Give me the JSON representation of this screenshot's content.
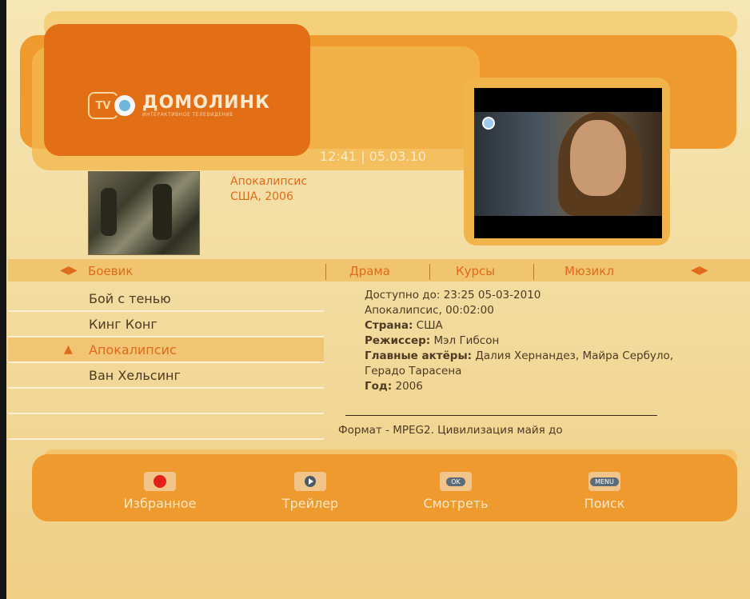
{
  "header": {
    "logo_badge": "TV",
    "logo_name": "ДОМОЛИНК",
    "logo_tagline": "ИНТЕРАКТИВНОЕ ТЕЛЕВИДЕНИЕ",
    "datetime": "12:41 | 05.03.10"
  },
  "movie": {
    "title": "Апокалипсис",
    "country_year": "США, 2006"
  },
  "categories": {
    "active": "Боевик",
    "items": [
      "Драма",
      "Курсы",
      "Мюзикл"
    ]
  },
  "list": {
    "items": [
      "Бой с тенью",
      "Кинг Конг",
      "Апокалипсис",
      "Ван Хельсинг"
    ],
    "selected_index": 2
  },
  "details": {
    "available": "Доступно до: 23:25 05-03-2010",
    "title_duration": "Апокалипсис, 00:02:00",
    "country_label": "Страна:",
    "country_value": "США",
    "director_label": "Режиссер:",
    "director_value": "Мэл Гибсон",
    "actors_label": "Главные актёры:",
    "actors_value": "Далия Хернандез, Майра Сербуло, Герадо Тарасена",
    "year_label": "Год:",
    "year_value": "2006",
    "format": "Формат - MPEG2. Цивилизация майя до"
  },
  "footer": {
    "favorites": "Избранное",
    "trailer": "Трейлер",
    "watch": "Смотреть",
    "watch_key": "OK",
    "search": "Поиск",
    "search_key": "MENU"
  },
  "colors": {
    "accent": "#e06a1b",
    "band": "#ef9a2e",
    "background": "#f3dfa8"
  }
}
